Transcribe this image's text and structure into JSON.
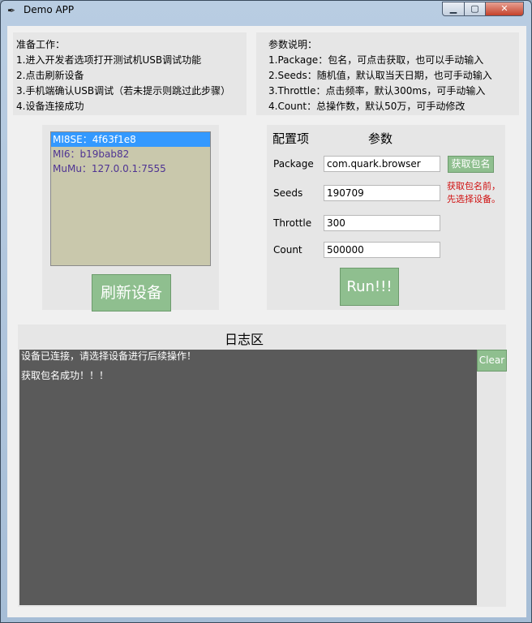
{
  "window": {
    "title": "Demo APP"
  },
  "prep": {
    "title": "准备工作：",
    "lines": [
      "1.进入开发者选项打开测试机USB调试功能",
      "2.点击刷新设备",
      "3.手机端确认USB调试（若未提示则跳过此步骤）",
      "4.设备连接成功"
    ]
  },
  "params_help": {
    "title": "参数说明：",
    "lines": [
      "1.Package：包名，可点击获取，也可以手动输入",
      "2.Seeds：随机值，默认取当天日期，也可手动输入",
      "3.Throttle：点击频率，默认300ms，可手动输入",
      "4.Count：总操作数，默认50万，可手动修改"
    ]
  },
  "devices": [
    "MI8SE：4f63f1e8",
    "MI6：b19bab82",
    "MuMu：127.0.0.1:7555"
  ],
  "refresh_label": "刷新设备",
  "config": {
    "col_config": "配置项",
    "col_param": "参数",
    "package_label": "Package",
    "package_value": "com.quark.browser",
    "get_pkg_label": "获取包名",
    "seeds_label": "Seeds",
    "seeds_value": "190709",
    "warn_line1": "获取包名前，",
    "warn_line2": "先选择设备。",
    "throttle_label": "Throttle",
    "throttle_value": "300",
    "count_label": "Count",
    "count_value": "500000",
    "run_label": "Run!!!"
  },
  "log": {
    "title": "日志区",
    "lines": [
      "设备已连接，请选择设备进行后续操作！",
      "获取包名成功！！！"
    ],
    "clear_label": "Clear"
  }
}
